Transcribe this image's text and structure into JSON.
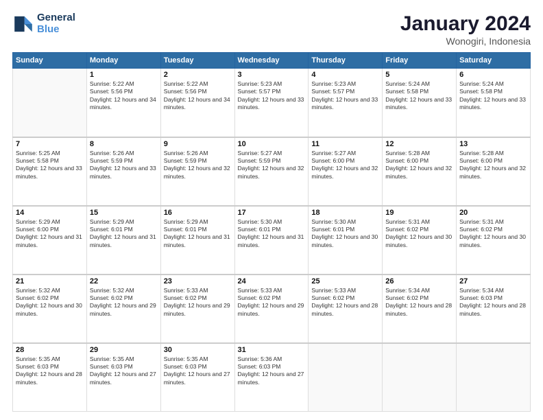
{
  "logo": {
    "line1": "General",
    "line2": "Blue"
  },
  "title": "January 2024",
  "subtitle": "Wonogiri, Indonesia",
  "weekdays": [
    "Sunday",
    "Monday",
    "Tuesday",
    "Wednesday",
    "Thursday",
    "Friday",
    "Saturday"
  ],
  "weeks": [
    [
      {
        "day": "",
        "sunrise": "",
        "sunset": "",
        "daylight": ""
      },
      {
        "day": "1",
        "sunrise": "5:22 AM",
        "sunset": "5:56 PM",
        "daylight": "12 hours and 34 minutes."
      },
      {
        "day": "2",
        "sunrise": "5:22 AM",
        "sunset": "5:56 PM",
        "daylight": "12 hours and 34 minutes."
      },
      {
        "day": "3",
        "sunrise": "5:23 AM",
        "sunset": "5:57 PM",
        "daylight": "12 hours and 33 minutes."
      },
      {
        "day": "4",
        "sunrise": "5:23 AM",
        "sunset": "5:57 PM",
        "daylight": "12 hours and 33 minutes."
      },
      {
        "day": "5",
        "sunrise": "5:24 AM",
        "sunset": "5:58 PM",
        "daylight": "12 hours and 33 minutes."
      },
      {
        "day": "6",
        "sunrise": "5:24 AM",
        "sunset": "5:58 PM",
        "daylight": "12 hours and 33 minutes."
      }
    ],
    [
      {
        "day": "7",
        "sunrise": "5:25 AM",
        "sunset": "5:58 PM",
        "daylight": "12 hours and 33 minutes."
      },
      {
        "day": "8",
        "sunrise": "5:26 AM",
        "sunset": "5:59 PM",
        "daylight": "12 hours and 33 minutes."
      },
      {
        "day": "9",
        "sunrise": "5:26 AM",
        "sunset": "5:59 PM",
        "daylight": "12 hours and 32 minutes."
      },
      {
        "day": "10",
        "sunrise": "5:27 AM",
        "sunset": "5:59 PM",
        "daylight": "12 hours and 32 minutes."
      },
      {
        "day": "11",
        "sunrise": "5:27 AM",
        "sunset": "6:00 PM",
        "daylight": "12 hours and 32 minutes."
      },
      {
        "day": "12",
        "sunrise": "5:28 AM",
        "sunset": "6:00 PM",
        "daylight": "12 hours and 32 minutes."
      },
      {
        "day": "13",
        "sunrise": "5:28 AM",
        "sunset": "6:00 PM",
        "daylight": "12 hours and 32 minutes."
      }
    ],
    [
      {
        "day": "14",
        "sunrise": "5:29 AM",
        "sunset": "6:00 PM",
        "daylight": "12 hours and 31 minutes."
      },
      {
        "day": "15",
        "sunrise": "5:29 AM",
        "sunset": "6:01 PM",
        "daylight": "12 hours and 31 minutes."
      },
      {
        "day": "16",
        "sunrise": "5:29 AM",
        "sunset": "6:01 PM",
        "daylight": "12 hours and 31 minutes."
      },
      {
        "day": "17",
        "sunrise": "5:30 AM",
        "sunset": "6:01 PM",
        "daylight": "12 hours and 31 minutes."
      },
      {
        "day": "18",
        "sunrise": "5:30 AM",
        "sunset": "6:01 PM",
        "daylight": "12 hours and 30 minutes."
      },
      {
        "day": "19",
        "sunrise": "5:31 AM",
        "sunset": "6:02 PM",
        "daylight": "12 hours and 30 minutes."
      },
      {
        "day": "20",
        "sunrise": "5:31 AM",
        "sunset": "6:02 PM",
        "daylight": "12 hours and 30 minutes."
      }
    ],
    [
      {
        "day": "21",
        "sunrise": "5:32 AM",
        "sunset": "6:02 PM",
        "daylight": "12 hours and 30 minutes."
      },
      {
        "day": "22",
        "sunrise": "5:32 AM",
        "sunset": "6:02 PM",
        "daylight": "12 hours and 29 minutes."
      },
      {
        "day": "23",
        "sunrise": "5:33 AM",
        "sunset": "6:02 PM",
        "daylight": "12 hours and 29 minutes."
      },
      {
        "day": "24",
        "sunrise": "5:33 AM",
        "sunset": "6:02 PM",
        "daylight": "12 hours and 29 minutes."
      },
      {
        "day": "25",
        "sunrise": "5:33 AM",
        "sunset": "6:02 PM",
        "daylight": "12 hours and 28 minutes."
      },
      {
        "day": "26",
        "sunrise": "5:34 AM",
        "sunset": "6:02 PM",
        "daylight": "12 hours and 28 minutes."
      },
      {
        "day": "27",
        "sunrise": "5:34 AM",
        "sunset": "6:03 PM",
        "daylight": "12 hours and 28 minutes."
      }
    ],
    [
      {
        "day": "28",
        "sunrise": "5:35 AM",
        "sunset": "6:03 PM",
        "daylight": "12 hours and 28 minutes."
      },
      {
        "day": "29",
        "sunrise": "5:35 AM",
        "sunset": "6:03 PM",
        "daylight": "12 hours and 27 minutes."
      },
      {
        "day": "30",
        "sunrise": "5:35 AM",
        "sunset": "6:03 PM",
        "daylight": "12 hours and 27 minutes."
      },
      {
        "day": "31",
        "sunrise": "5:36 AM",
        "sunset": "6:03 PM",
        "daylight": "12 hours and 27 minutes."
      },
      {
        "day": "",
        "sunrise": "",
        "sunset": "",
        "daylight": ""
      },
      {
        "day": "",
        "sunrise": "",
        "sunset": "",
        "daylight": ""
      },
      {
        "day": "",
        "sunrise": "",
        "sunset": "",
        "daylight": ""
      }
    ]
  ]
}
